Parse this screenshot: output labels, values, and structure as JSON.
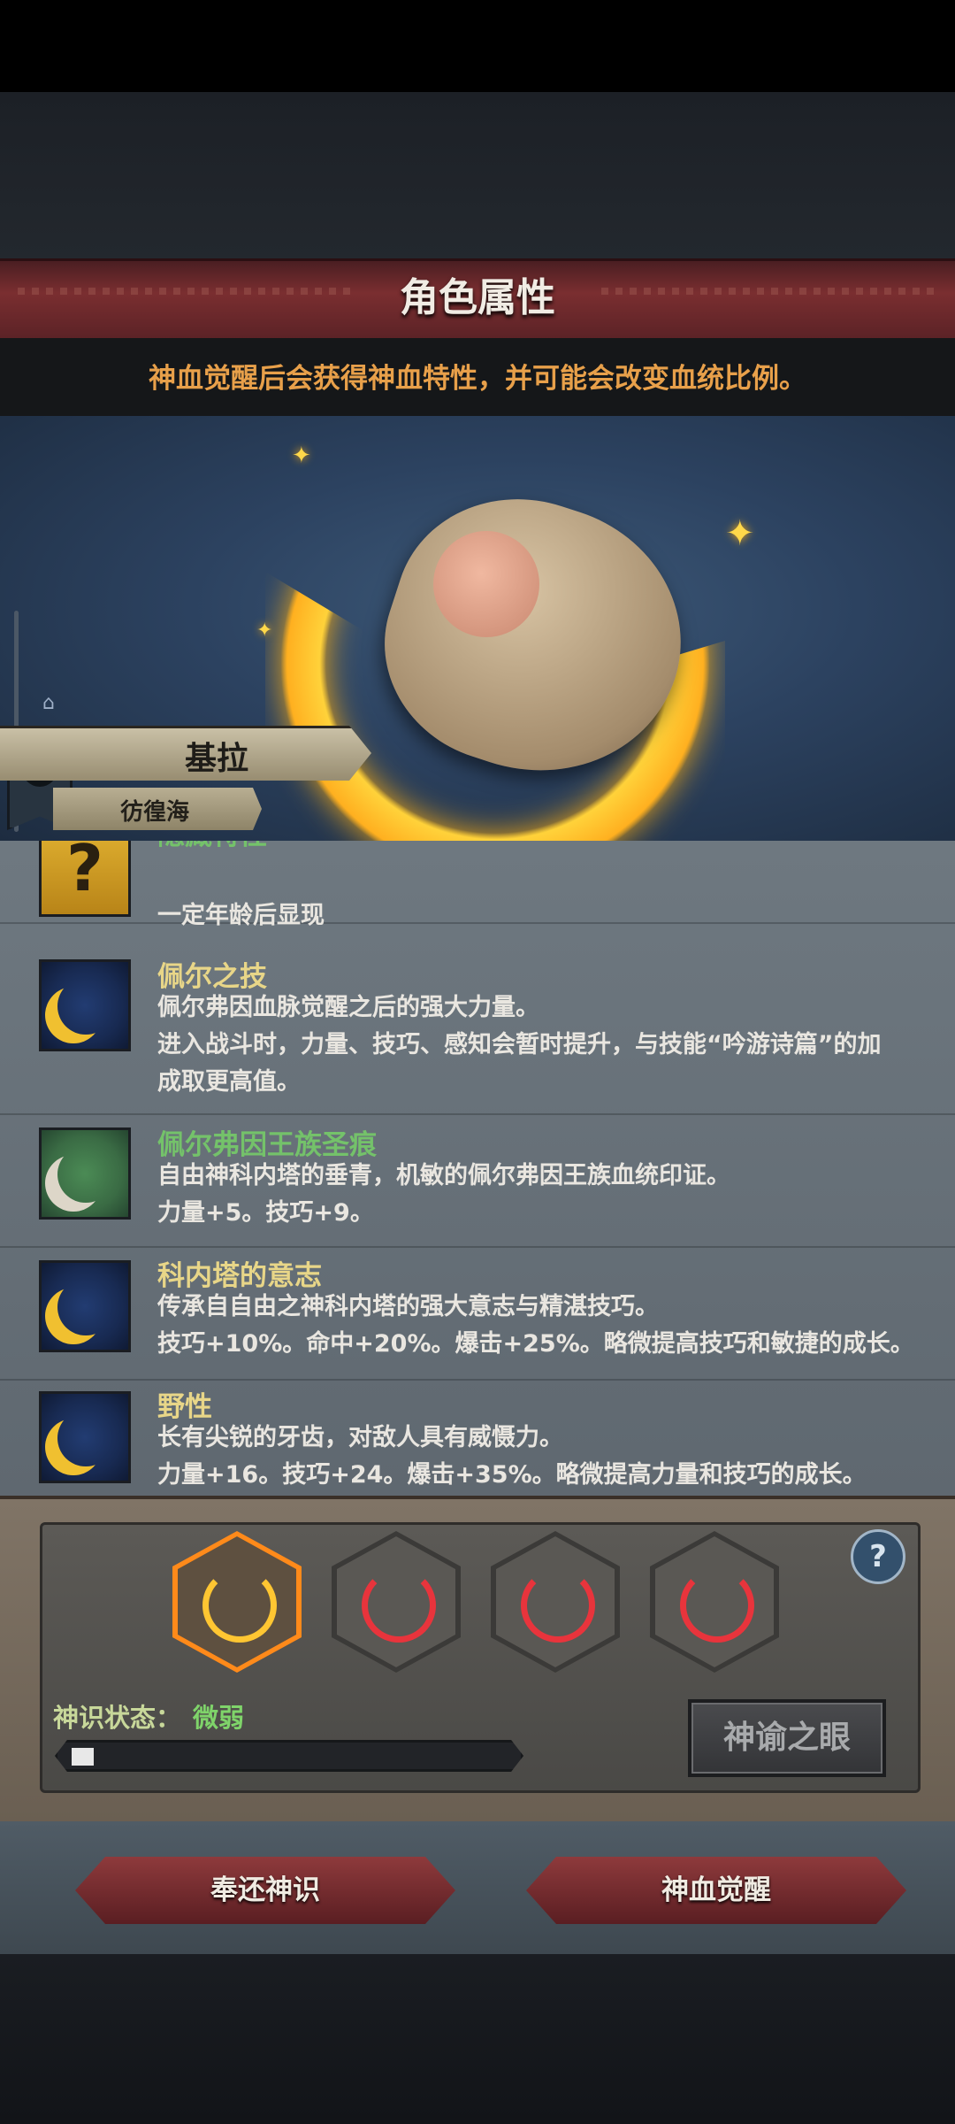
{
  "page": {
    "title": "角色属性",
    "subtitle": "神血觉醒后会获得神血特性，并可能会改变血统比例。"
  },
  "character": {
    "name": "基拉",
    "origin": "彷徨海"
  },
  "traits": [
    {
      "name": "隐藏特性",
      "icon": "question-icon",
      "name_color": "#74c26a",
      "lines": [
        "",
        "一定年龄后显现"
      ]
    },
    {
      "name": "佩尔之技",
      "icon": "crescent-moon-icon",
      "name_color": "#e8d688",
      "lines": [
        "佩尔弗因血脉觉醒之后的强大力量。",
        "进入战斗时，力量、技巧、感知会暂时提升，与技能“吟游诗篇”的加",
        "成取更高值。"
      ]
    },
    {
      "name": "佩尔弗因王族圣痕",
      "icon": "crescent-moon-icon",
      "name_color": "#74c26a",
      "lines": [
        "自由神科内塔的垂青，机敏的佩尔弗因王族血统印证。",
        "力量+5。技巧+9。"
      ]
    },
    {
      "name": "科内塔的意志",
      "icon": "crescent-moon-icon",
      "name_color": "#e8d688",
      "lines": [
        "传承自自由之神科内塔的强大意志与精湛技巧。",
        "技巧+10%。命中+20%。爆击+25%。略微提高技巧和敏捷的成长。"
      ]
    },
    {
      "name": "野性",
      "icon": "crescent-moon-icon",
      "name_color": "#e8d688",
      "lines": [
        "长有尖锐的牙齿，对敌人具有威慑力。",
        "力量+16。技巧+24。爆击+35%。略微提高力量和技巧的成长。"
      ]
    }
  ],
  "divine": {
    "slots": [
      "active",
      "locked",
      "locked",
      "locked"
    ],
    "status_label": "神识状态：",
    "status_value": "微弱",
    "progress": 0.05,
    "oracle_button": "神谕之眼"
  },
  "actions": {
    "return_label": "奉还神识",
    "awaken_label": "神血觉醒"
  },
  "colors": {
    "accent_orange": "#e8a04a",
    "title_band": "#7a2e30",
    "status_green": "#7fd46a",
    "slot_active": "#ff8a1a",
    "slot_locked": "#e8343c"
  }
}
